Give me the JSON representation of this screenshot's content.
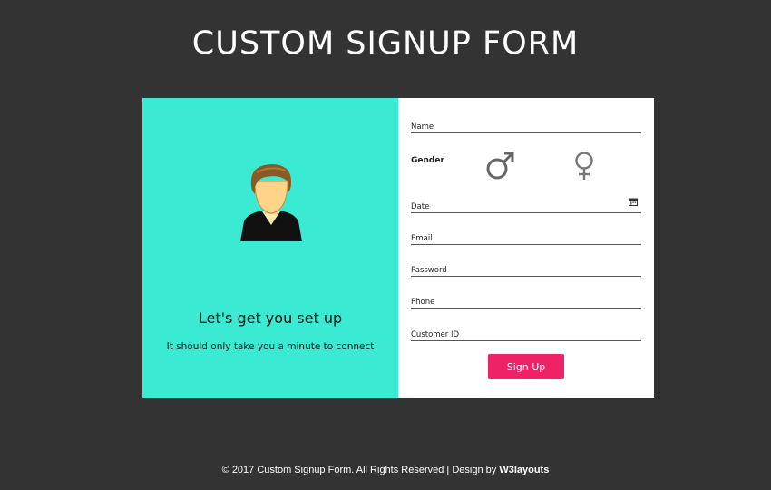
{
  "header": {
    "title": "CUSTOM SIGNUP FORM"
  },
  "left_panel": {
    "avatar_icon": "user-avatar-icon",
    "tagline": "Let's get you set up",
    "subtagline": "It should only take you a minute to connect",
    "background_color": "#3aead2"
  },
  "form": {
    "name_placeholder": "Name",
    "gender_label": "Gender",
    "male_icon": "male-symbol-icon",
    "female_icon": "female-symbol-icon",
    "date_placeholder": "Date",
    "calendar_icon": "calendar-icon",
    "email_placeholder": "Email",
    "password_placeholder": "Password",
    "phone_placeholder": "Phone",
    "customer_id_placeholder": "Customer ID",
    "signup_label": "Sign Up",
    "button_color": "#ee2266"
  },
  "footer": {
    "text": "© 2017 Custom Signup Form. All Rights Reserved | Design by",
    "brand": "W3layouts"
  }
}
